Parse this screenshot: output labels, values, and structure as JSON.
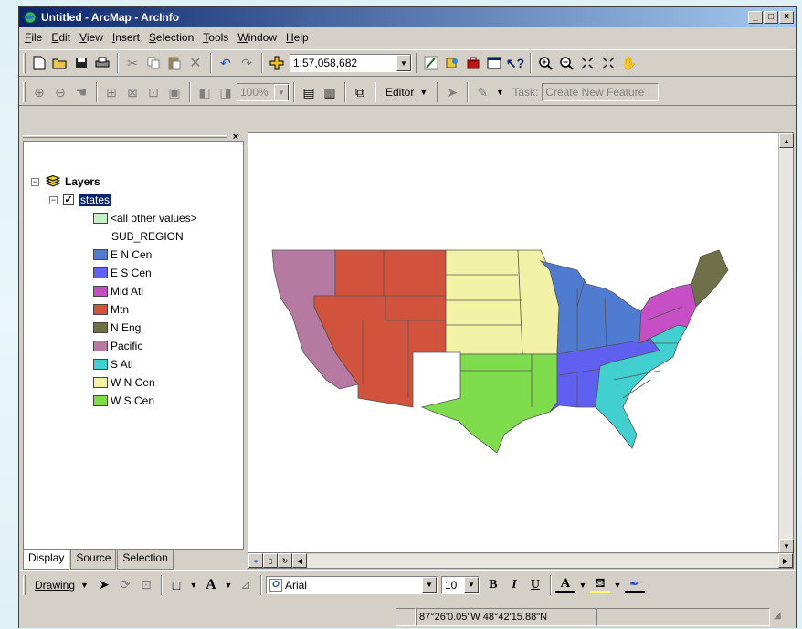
{
  "window": {
    "title": "Untitled - ArcMap - ArcInfo",
    "minimize": "_",
    "maximize": "□",
    "close": "×"
  },
  "menu": [
    "File",
    "Edit",
    "View",
    "Insert",
    "Selection",
    "Tools",
    "Window",
    "Help"
  ],
  "menu_keys": [
    "F",
    "E",
    "V",
    "I",
    "S",
    "T",
    "W",
    "H"
  ],
  "standard_toolbar": {
    "scale": "1:57,058,682"
  },
  "tools_toolbar": {
    "zoom_pct": "100%",
    "editor_label": "Editor",
    "task_label": "Task:",
    "task_value": "Create New Feature"
  },
  "toc": {
    "layers_label": "Layers",
    "layer_name": "states",
    "other_values": "<all other values>",
    "field": "SUB_REGION",
    "legend": [
      {
        "label": "E N Cen",
        "color": "#4f7bd1"
      },
      {
        "label": "E S Cen",
        "color": "#5f5ff0"
      },
      {
        "label": "Mid Atl",
        "color": "#c64fc6"
      },
      {
        "label": "Mtn",
        "color": "#d2533d"
      },
      {
        "label": "N Eng",
        "color": "#6f7049"
      },
      {
        "label": "Pacific",
        "color": "#b579a2"
      },
      {
        "label": "S Atl",
        "color": "#41cfcf"
      },
      {
        "label": "W N Cen",
        "color": "#f2f2a6"
      },
      {
        "label": "W S Cen",
        "color": "#7fdc4c"
      }
    ],
    "other_color": "#c5f0c5",
    "tabs": [
      "Display",
      "Source",
      "Selection"
    ]
  },
  "drawing_toolbar": {
    "drawing_label": "Drawing",
    "font_name": "Arial",
    "font_size": "10",
    "bold": "B",
    "italic": "I",
    "underline": "U"
  },
  "status": {
    "coords": "87°26'0.05\"W  48°42'15.88\"N"
  }
}
